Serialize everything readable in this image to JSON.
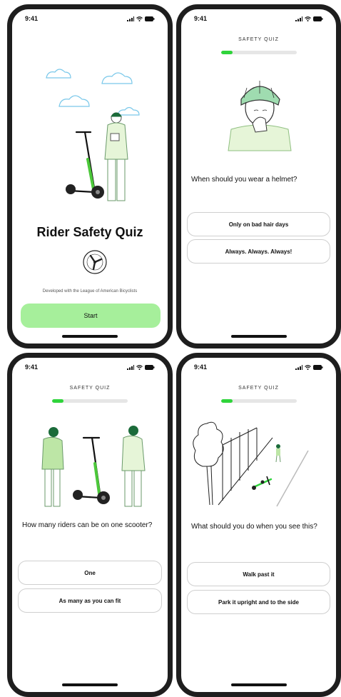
{
  "status_time": "9:41",
  "intro": {
    "title": "Rider Safety Quiz",
    "developed_with": "Developed with the League of American Bicyclists",
    "start_label": "Start",
    "seal_icon": "league-of-american-bicyclists-seal"
  },
  "quiz_title": "SAFETY QUIZ",
  "progress_fraction": 0.15,
  "accent_color": "#2fd43b",
  "start_button_color": "#a6ef9b",
  "questions": [
    {
      "question": "When should you wear a helmet?",
      "answers": [
        "Only on bad hair days",
        "Always. Always. Always!"
      ]
    },
    {
      "question": "How many riders can be on one scooter?",
      "answers": [
        "One",
        "As many as you can fit"
      ]
    },
    {
      "question": "What should you do when you see this?",
      "answers": [
        "Walk past it",
        "Park it upright and to the side"
      ]
    }
  ]
}
